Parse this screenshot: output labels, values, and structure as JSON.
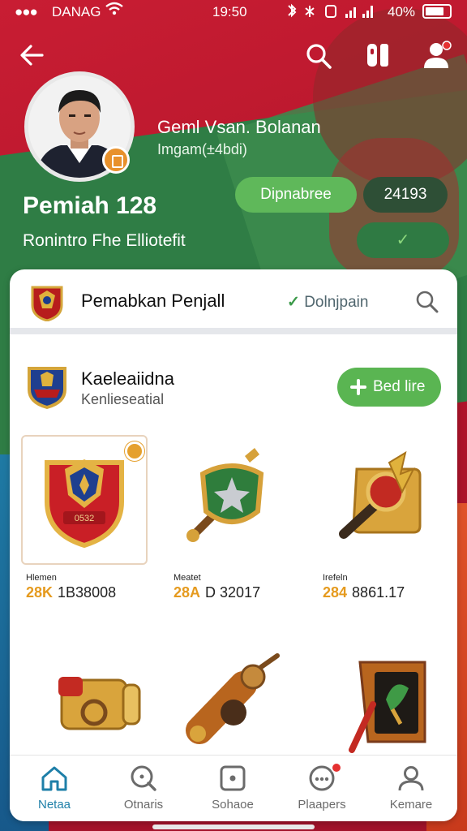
{
  "status_bar": {
    "dots": "●●●",
    "carrier": "DANAG",
    "time": "19:50",
    "battery_percent": "40%"
  },
  "profile": {
    "name_line": "Geml Vsan. Bolanan",
    "sub_line": "Imgam(±4bdi)",
    "rank_title": "Pemiah 128",
    "rank_subtitle": "Ronintro Fhe Elliotefit",
    "primary_pill": "Dipnabree",
    "score_pill": "24193",
    "check_pill": "✓"
  },
  "card": {
    "header": {
      "title": "Pemabkan Penjall",
      "link_icon": "✓",
      "link_text": "Dolnjpain"
    },
    "category": {
      "title": "Kaeleaiidna",
      "subtitle": "Kenlieseatial",
      "add_button": "Bed lire"
    },
    "items": [
      {
        "label": "Hlemen",
        "price_accent": "28K",
        "price": "1B38008",
        "art": "red-shield"
      },
      {
        "label": "Meatet",
        "price_accent": "28A",
        "price": "D 32017",
        "art": "green-shield"
      },
      {
        "label": "Irefeln",
        "price_accent": "284",
        "price": "8861.17",
        "art": "golden-hammer"
      },
      {
        "art": "golden-scroll"
      },
      {
        "art": "bronze-cannon"
      },
      {
        "art": "dark-banner"
      }
    ]
  },
  "bottom_nav": [
    {
      "label": "Netaa",
      "icon": "home-icon",
      "active": true
    },
    {
      "label": "Otnaris",
      "icon": "search-icon",
      "active": false
    },
    {
      "label": "Sohaoe",
      "icon": "square-icon",
      "active": false
    },
    {
      "label": "Plaapers",
      "icon": "chat-icon",
      "active": false
    },
    {
      "label": "Kemare",
      "icon": "person-icon",
      "active": false
    }
  ],
  "colors": {
    "primary_red": "#c81d33",
    "green": "#5ab552",
    "accent_gold": "#e59a1e",
    "active_blue": "#1e7fa8"
  }
}
